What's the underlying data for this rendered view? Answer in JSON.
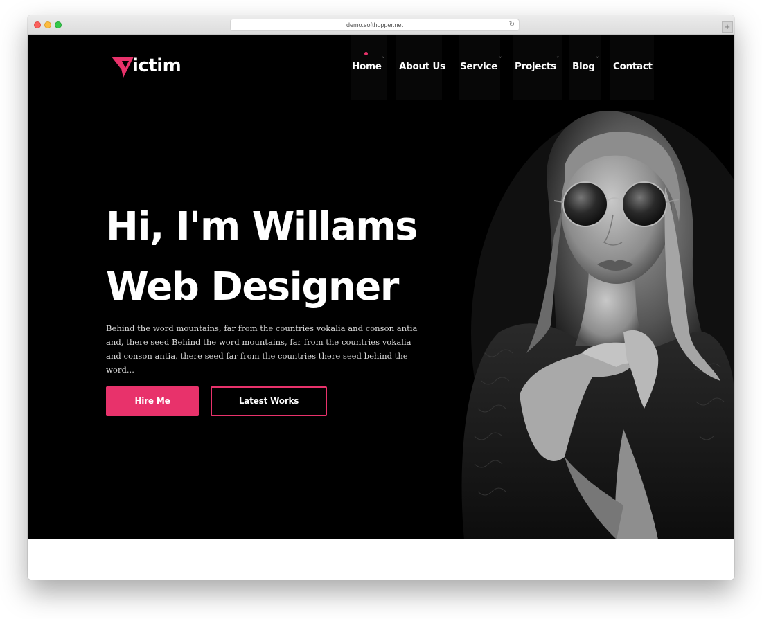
{
  "browser": {
    "url": "demo.softhopper.net",
    "reload_icon": "reload-icon",
    "new_tab_symbol": "+"
  },
  "logo": {
    "mark_icon": "victim-v-logo-icon",
    "text": "ictim"
  },
  "nav": {
    "items": [
      {
        "label": "Home",
        "active": true,
        "has_dropdown": true
      },
      {
        "label": "About Us",
        "active": false,
        "has_dropdown": false
      },
      {
        "label": "Service",
        "active": false,
        "has_dropdown": true
      },
      {
        "label": "Projects",
        "active": false,
        "has_dropdown": true
      },
      {
        "label": "Blog",
        "active": false,
        "has_dropdown": true
      },
      {
        "label": "Contact",
        "active": false,
        "has_dropdown": false
      }
    ],
    "dropdown_symbol": "ˇ",
    "active_indicator_color": "#e8326b"
  },
  "hero": {
    "heading_line1": "Hi, I'm Willams",
    "heading_line2": "Web Designer",
    "description": "Behind the word mountains, far from the countries vokalia and conson antia and, there seed Behind the word mountains, far from the countries vokalia and conson antia, there seed far from the countries there seed behind the word...",
    "primary_button": "Hire Me",
    "secondary_button": "Latest Works"
  },
  "colors": {
    "accent": "#e8326b",
    "background": "#000000",
    "text": "#ffffff"
  }
}
